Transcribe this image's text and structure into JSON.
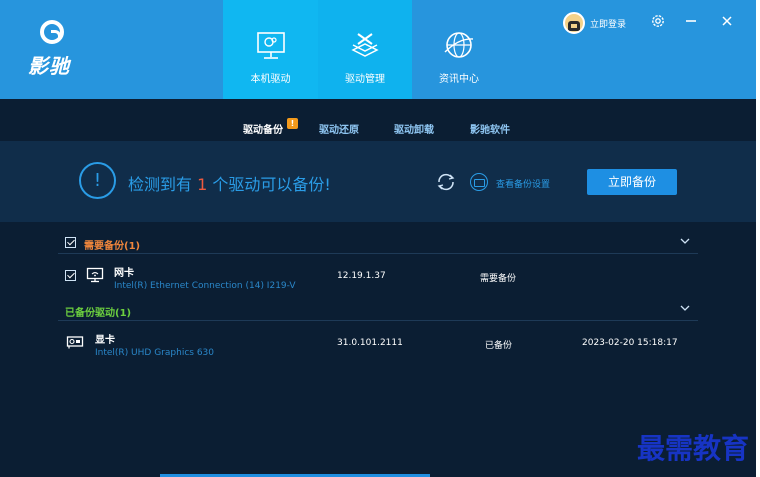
{
  "logo": {
    "text": "影驰"
  },
  "nav": [
    {
      "label": "本机驱动",
      "icon": "monitor-icon"
    },
    {
      "label": "驱动管理",
      "icon": "tools-icon"
    },
    {
      "label": "资讯中心",
      "icon": "globe-icon"
    }
  ],
  "header": {
    "login_label": "立即登录"
  },
  "tabs": [
    {
      "label": "驱动备份",
      "badge": "!"
    },
    {
      "label": "驱动还原"
    },
    {
      "label": "驱动卸载"
    },
    {
      "label": "影驰软件"
    }
  ],
  "banner": {
    "prefix": "检测到有",
    "count": "1",
    "suffix": "个驱动可以备份!",
    "settings_label": "查看备份设置",
    "backup_button": "立即备份"
  },
  "sections": [
    {
      "title": "需要备份(1)",
      "rows": [
        {
          "name": "网卡",
          "desc": "Intel(R) Ethernet Connection (14) I219-V",
          "version": "12.19.1.37",
          "status": "需要备份",
          "date": ""
        }
      ]
    },
    {
      "title": "已备份驱动(1)",
      "rows": [
        {
          "name": "显卡",
          "desc": "Intel(R) UHD Graphics 630",
          "version": "31.0.101.2111",
          "status": "已备份",
          "date": "2023-02-20 15:18:17"
        }
      ]
    }
  ],
  "watermark": "最需教育",
  "colors": {
    "header": "#2795dd",
    "active_nav": "#10b7f1",
    "accent": "#2a9ce6",
    "warn": "#f0863c",
    "ok": "#6ccf3f",
    "count": "#ef5a3f"
  }
}
